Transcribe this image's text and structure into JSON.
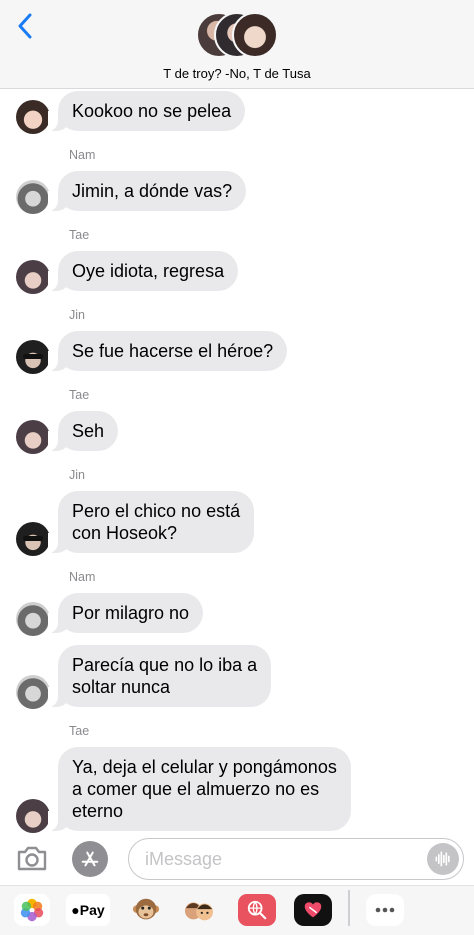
{
  "header": {
    "title": "T de troy? -No, T de Tusa"
  },
  "messages": [
    {
      "sender": "",
      "text": "Kookoo no se pelea",
      "avatar": "kook"
    },
    {
      "sender": "Nam",
      "text": "Jimin, a dónde vas?",
      "avatar": "nam"
    },
    {
      "sender": "Tae",
      "text": "Oye idiota, regresa",
      "avatar": "tae"
    },
    {
      "sender": "Jin",
      "text": "Se fue hacerse el héroe?",
      "avatar": "jin"
    },
    {
      "sender": "Tae",
      "text": "Seh",
      "avatar": "tae"
    },
    {
      "sender": "Jin",
      "text_lines": [
        "Pero el chico no está",
        "con Hoseok?"
      ],
      "avatar": "jin"
    },
    {
      "sender": "Nam",
      "text": "Por milagro no",
      "avatar": "nam"
    },
    {
      "sender": "",
      "text_lines": [
        "Parecía que no lo iba a",
        "soltar nunca"
      ],
      "avatar": "nam"
    },
    {
      "sender": "Tae",
      "text_lines": [
        "Ya, deja el celular y pongámonos",
        "a comer que el almuerzo no es",
        "eterno"
      ],
      "avatar": "tae"
    }
  ],
  "input": {
    "placeholder": "iMessage"
  },
  "drawer": {
    "apple_pay_label": "Pay"
  },
  "colors": {
    "accent": "#1a7cf5",
    "bubble_incoming": "#e9e9eb",
    "sender_label": "#8a8a8e",
    "header_bg": "#f6f6f7"
  }
}
